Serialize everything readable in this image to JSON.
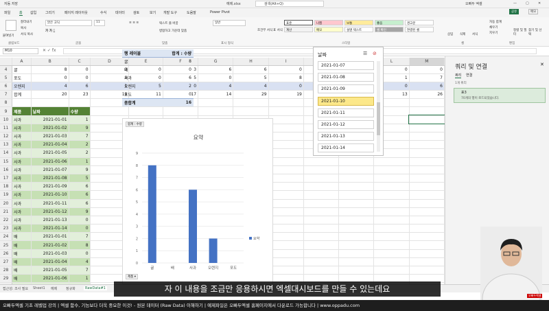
{
  "titlebar": {
    "autosave": "자동 저장",
    "file": "예제.xlsx",
    "search": "검색(Alt+Q)",
    "user": "오빠두 엑셀"
  },
  "menu": [
    "파일",
    "홈",
    "삽입",
    "그리기",
    "페이지 레이아웃",
    "수식",
    "데이터",
    "검토",
    "보기",
    "개발 도구",
    "도움말",
    "Power Pivot"
  ],
  "share": {
    "share": "공유",
    "memo": "메모"
  },
  "ribbon": {
    "font_name": "맑은 고딕",
    "font_size": "11",
    "number_format": "일반",
    "groups": [
      "클립보드",
      "글꼴",
      "맞춤",
      "표시 형식",
      "스타일",
      "셀",
      "편집"
    ],
    "clipboard": [
      "붙여넣기",
      "잘라내기",
      "복사",
      "서식 복사"
    ],
    "align": [
      "텍스트 줄 바꿈",
      "병합하고 가운데 맞춤"
    ],
    "styles": [
      {
        "label": "표준",
        "bg": "#ffffff"
      },
      {
        "label": "나쁨",
        "bg": "#ffc7ce"
      },
      {
        "label": "보통",
        "bg": "#ffeb9c"
      },
      {
        "label": "좋음",
        "bg": "#c6efce"
      },
      {
        "label": "경고문",
        "bg": "#ffffff"
      },
      {
        "label": "계산",
        "bg": "#f2f2f2"
      },
      {
        "label": "메모",
        "bg": "#ffffcc"
      },
      {
        "label": "설명 텍스트",
        "bg": "#ffffff"
      },
      {
        "label": "셀 확인",
        "bg": "#a5a5a5"
      },
      {
        "label": "연결된 셀",
        "bg": "#ffffff"
      }
    ],
    "conditional": "조건부 서식",
    "as_table": "표 서식",
    "cell_style": "셀 스타일",
    "cells": [
      "삽입",
      "삭제",
      "서식"
    ],
    "edit": [
      "자동 합계",
      "채우기",
      "지우기",
      "정렬 및 필터",
      "찾기 및 선택"
    ]
  },
  "namebox": "M10",
  "columns": [
    "A",
    "B",
    "C",
    "D",
    "E",
    "F",
    "G",
    "H",
    "I",
    "J",
    "K",
    "L",
    "M"
  ],
  "top_rows": [
    {
      "n": "4",
      "cells": [
        "귤",
        "8",
        "0",
        "2",
        "0",
        "3",
        "6",
        "6",
        "0",
        "1",
        "8",
        "0",
        "0"
      ]
    },
    {
      "n": "5",
      "cells": [
        "포도",
        "0",
        "0",
        "9",
        "0",
        "5",
        "0",
        "5",
        "8",
        "8",
        "0",
        "1",
        "7"
      ]
    },
    {
      "n": "6",
      "cells": [
        "오렌지",
        "4",
        "6",
        "1",
        "5",
        "0",
        "4",
        "4",
        "0",
        "7",
        "2",
        "0",
        "6"
      ]
    },
    {
      "n": "7",
      "cells": [
        "합계",
        "20",
        "23",
        "19",
        "11",
        "17",
        "14",
        "29",
        "19",
        "22",
        "16",
        "13",
        "26"
      ]
    }
  ],
  "table": {
    "headers": [
      "제품",
      "날짜",
      "수량"
    ],
    "rows": [
      [
        "10",
        "사과",
        "2021-01-01",
        "1"
      ],
      [
        "11",
        "사과",
        "2021-01-02",
        "9"
      ],
      [
        "12",
        "사과",
        "2021-01-03",
        "7"
      ],
      [
        "13",
        "사과",
        "2021-01-04",
        "2"
      ],
      [
        "14",
        "사과",
        "2021-01-05",
        "2"
      ],
      [
        "15",
        "사과",
        "2021-01-06",
        "1"
      ],
      [
        "16",
        "사과",
        "2021-01-07",
        "9"
      ],
      [
        "17",
        "사과",
        "2021-01-08",
        "5"
      ],
      [
        "18",
        "사과",
        "2021-01-09",
        "6"
      ],
      [
        "19",
        "사과",
        "2021-01-10",
        "6"
      ],
      [
        "20",
        "사과",
        "2021-01-11",
        "6"
      ],
      [
        "21",
        "사과",
        "2021-01-12",
        "9"
      ],
      [
        "22",
        "사과",
        "2021-01-13",
        "0"
      ],
      [
        "23",
        "사과",
        "2021-01-14",
        "0"
      ],
      [
        "24",
        "배",
        "2021-01-01",
        "7"
      ],
      [
        "25",
        "배",
        "2021-01-02",
        "8"
      ],
      [
        "26",
        "배",
        "2021-01-03",
        "0"
      ],
      [
        "27",
        "배",
        "2021-01-04",
        "4"
      ],
      [
        "28",
        "배",
        "2021-01-05",
        "7"
      ],
      [
        "29",
        "배",
        "2021-01-06",
        "1"
      ],
      [
        "30",
        "배",
        "2021-01-07",
        "8"
      ]
    ]
  },
  "pivot": {
    "row_label": "행 레이블",
    "sum_label": "합계 : 수량",
    "rows": [
      [
        "귤",
        "8"
      ],
      [
        "배",
        "0"
      ],
      [
        "사과",
        "6"
      ],
      [
        "오렌지",
        "2"
      ],
      [
        "포도",
        "0"
      ]
    ],
    "total_label": "총합계",
    "total": "16"
  },
  "chart_data": {
    "type": "bar",
    "title": "요약",
    "categories": [
      "귤",
      "배",
      "사과",
      "오렌지",
      "포도"
    ],
    "series": [
      {
        "name": "요약",
        "values": [
          8,
          0,
          6,
          2,
          0
        ]
      }
    ],
    "ylim": [
      0,
      9
    ],
    "yticks": [
      "0",
      "1",
      "2",
      "3",
      "4",
      "5",
      "6",
      "7",
      "8",
      "9"
    ],
    "field_button": "합계 : 수량",
    "axis_button": "제품",
    "color": "#4472c4"
  },
  "slicer": {
    "title": "날짜",
    "items": [
      "2021-01-07",
      "2021-01-08",
      "2021-01-09",
      "2021-01-10",
      "2021-01-11",
      "2021-01-12",
      "2021-01-13",
      "2021-01-14"
    ],
    "selected": "2021-01-10"
  },
  "pane": {
    "title": "쿼리 및 연결",
    "tabs": [
      "쿼리",
      "연결"
    ],
    "count": "1개 쿼리",
    "query_name": "표3",
    "query_desc": "70개의 행이 로드되었습니다."
  },
  "sheet_tabs": [
    "Sheet1",
    "예제",
    "정규화",
    "RawData#1"
  ],
  "status": "접근성: 조사 필요",
  "caption": "자 이 내용을 조금만 응용하시면 엑셀대시보드를 만들 수 있는데요",
  "ticker": "오빠두엑셀 기초 레벨업 강의 | 엑셀 함수, 기능보다 더욱 중요한 이것! - 원본 데이터 (Raw Data) 이해하기 | 예제파일은 오빠두엑셀 홈페이지에서 다운로드 가능합니다 | www.oppadu.com",
  "logo": "오빠두엑셀"
}
